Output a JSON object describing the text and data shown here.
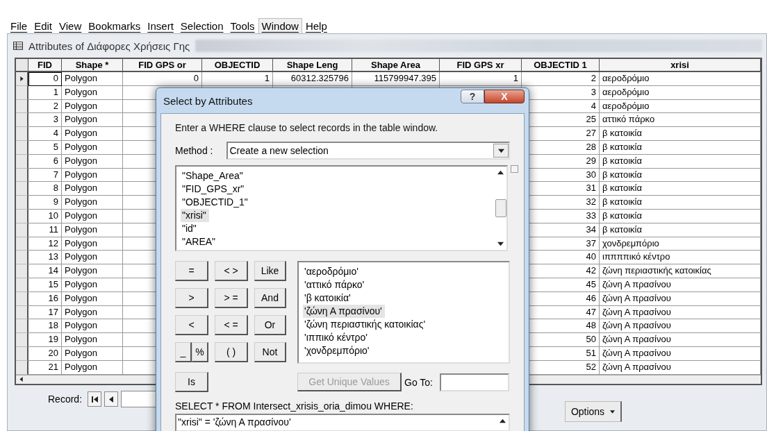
{
  "menu": [
    {
      "label": "File",
      "selected": false
    },
    {
      "label": "Edit",
      "selected": false
    },
    {
      "label": "View",
      "selected": false
    },
    {
      "label": "Bookmarks",
      "selected": false
    },
    {
      "label": "Insert",
      "selected": false
    },
    {
      "label": "Selection",
      "selected": false
    },
    {
      "label": "Tools",
      "selected": false
    },
    {
      "label": "Window",
      "selected": true
    },
    {
      "label": "Help",
      "selected": false
    }
  ],
  "window": {
    "title": "Attributes of Διάφορες Χρήσεις Γης"
  },
  "table": {
    "columns": [
      "FID",
      "Shape *",
      "FID GPS or",
      "OBJECTID",
      "Shape Leng",
      "Shape Area",
      "FID GPS xr",
      "OBJECTID 1",
      "xrisi"
    ],
    "rows": [
      {
        "selected": true,
        "cells": [
          "0",
          "Polygon",
          "0",
          "1",
          "60312.325796",
          "115799947.395",
          "1",
          "2",
          "αεροδρόμιο"
        ]
      },
      {
        "selected": false,
        "cells": [
          "1",
          "Polygon",
          "",
          "",
          "",
          "",
          "",
          "3",
          "αεροδρόμιο"
        ]
      },
      {
        "selected": false,
        "cells": [
          "2",
          "Polygon",
          "",
          "",
          "",
          "",
          "",
          "4",
          "αεροδρόμιο"
        ]
      },
      {
        "selected": false,
        "cells": [
          "3",
          "Polygon",
          "",
          "",
          "",
          "",
          "",
          "25",
          "αττικό πάρκο"
        ]
      },
      {
        "selected": false,
        "cells": [
          "4",
          "Polygon",
          "",
          "",
          "",
          "",
          "",
          "27",
          "β κατοικία"
        ]
      },
      {
        "selected": false,
        "cells": [
          "5",
          "Polygon",
          "",
          "",
          "",
          "",
          "",
          "28",
          "β κατοικία"
        ]
      },
      {
        "selected": false,
        "cells": [
          "6",
          "Polygon",
          "",
          "",
          "",
          "",
          "",
          "29",
          "β κατοικία"
        ]
      },
      {
        "selected": false,
        "cells": [
          "7",
          "Polygon",
          "",
          "",
          "",
          "",
          "",
          "30",
          "β κατοικία"
        ]
      },
      {
        "selected": false,
        "cells": [
          "8",
          "Polygon",
          "",
          "",
          "",
          "",
          "",
          "31",
          "β κατοικία"
        ]
      },
      {
        "selected": false,
        "cells": [
          "9",
          "Polygon",
          "",
          "",
          "",
          "",
          "",
          "32",
          "β κατοικία"
        ]
      },
      {
        "selected": false,
        "cells": [
          "10",
          "Polygon",
          "",
          "",
          "",
          "",
          "",
          "33",
          "β κατοικία"
        ]
      },
      {
        "selected": false,
        "cells": [
          "11",
          "Polygon",
          "",
          "",
          "",
          "",
          "",
          "34",
          "β κατοικία"
        ]
      },
      {
        "selected": false,
        "cells": [
          "12",
          "Polygon",
          "",
          "",
          "",
          "",
          "",
          "37",
          "χονδρεμπόριο"
        ]
      },
      {
        "selected": false,
        "cells": [
          "13",
          "Polygon",
          "",
          "",
          "",
          "",
          "",
          "40",
          "ιππππικό κέντρο"
        ]
      },
      {
        "selected": false,
        "cells": [
          "14",
          "Polygon",
          "",
          "",
          "",
          "",
          "",
          "42",
          "ζώνη περιαστικής κατοικίας"
        ]
      },
      {
        "selected": false,
        "cells": [
          "15",
          "Polygon",
          "",
          "",
          "",
          "",
          "",
          "45",
          "ζώνη Α πρασίνου"
        ]
      },
      {
        "selected": false,
        "cells": [
          "16",
          "Polygon",
          "",
          "",
          "",
          "",
          "",
          "46",
          "ζώνη Α πρασίνου"
        ]
      },
      {
        "selected": false,
        "cells": [
          "17",
          "Polygon",
          "",
          "",
          "",
          "",
          "",
          "47",
          "ζώνη Α πρασίνου"
        ]
      },
      {
        "selected": false,
        "cells": [
          "18",
          "Polygon",
          "",
          "",
          "",
          "",
          "",
          "48",
          "ζώνη Α πρασίνου"
        ]
      },
      {
        "selected": false,
        "cells": [
          "19",
          "Polygon",
          "",
          "",
          "",
          "",
          "",
          "50",
          "ζώνη Α πρασίνου"
        ]
      },
      {
        "selected": false,
        "cells": [
          "20",
          "Polygon",
          "",
          "",
          "",
          "",
          "",
          "51",
          "ζώνη Α πρασίνου"
        ]
      },
      {
        "selected": false,
        "cells": [
          "21",
          "Polygon",
          "",
          "",
          "",
          "",
          "",
          "52",
          "ζώνη Α πρασίνου"
        ]
      }
    ]
  },
  "record_bar": {
    "label": "Record:",
    "options_button": "Options"
  },
  "dialog": {
    "title": "Select by Attributes",
    "help_button": "?",
    "close_button": "X",
    "instruction": "Enter a WHERE clause to select records in the table window.",
    "method_label": "Method :",
    "method_value": "Create a new selection",
    "fields": [
      {
        "label": "\"Shape_Area\"",
        "selected": false
      },
      {
        "label": "\"FID_GPS_xr\"",
        "selected": false
      },
      {
        "label": "\"OBJECTID_1\"",
        "selected": false
      },
      {
        "label": "\"xrisi\"",
        "selected": true
      },
      {
        "label": "\"id\"",
        "selected": false
      },
      {
        "label": "\"AREA\"",
        "selected": false
      }
    ],
    "operators": [
      [
        "=",
        "< >",
        "Like"
      ],
      [
        ">",
        "> =",
        "And"
      ],
      [
        "<",
        "< =",
        "Or"
      ],
      [
        "_",
        "%",
        "( )",
        "Not"
      ],
      [
        "Is"
      ]
    ],
    "values": [
      {
        "label": "'αεροδρόμιο'",
        "selected": false
      },
      {
        "label": "'αττικό πάρκο'",
        "selected": false
      },
      {
        "label": "'β κατοικία'",
        "selected": false
      },
      {
        "label": "'ζώνη Α πρασίνου'",
        "selected": true
      },
      {
        "label": "'ζώνη περιαστικής κατοικίας'",
        "selected": false
      },
      {
        "label": "'ιππικό κέντρο'",
        "selected": false
      },
      {
        "label": "'χονδρεμπόριο'",
        "selected": false
      }
    ],
    "unique_values_button": {
      "label": "Get Unique Values",
      "disabled": true
    },
    "goto_label": "Go To:",
    "sql_label": "SELECT * FROM Intersect_xrisis_oria_dimou WHERE:",
    "expression": "\"xrisi\" = 'ζώνη Α πρασίνου'"
  }
}
